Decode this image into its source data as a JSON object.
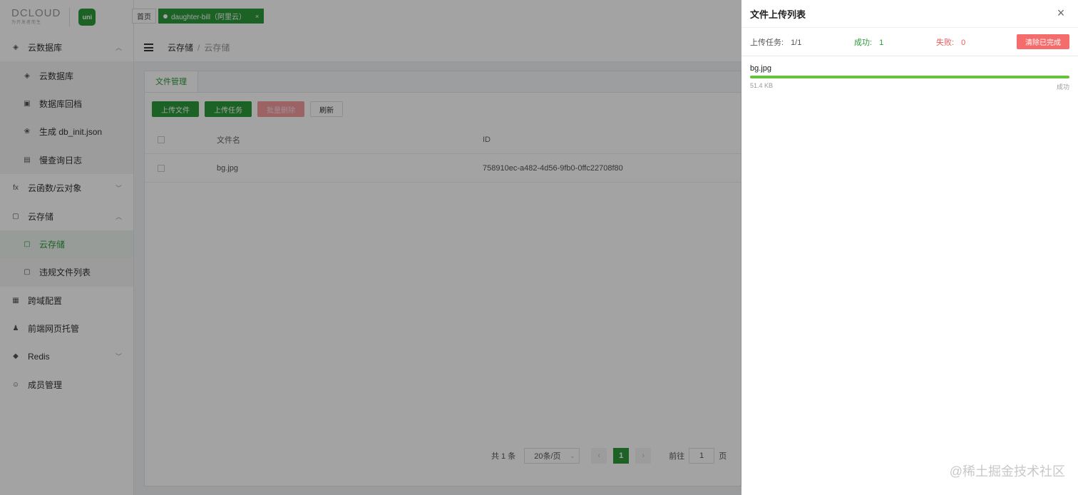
{
  "logo": {
    "dcloud": "DCLOUD",
    "dcloud_sub": "为开发者而生",
    "uni": "uni"
  },
  "tabs": {
    "home": "首页",
    "current": "daughter-bill（阿里云）",
    "close": "×"
  },
  "breadcrumb": {
    "first": "云存储",
    "sep": "/",
    "last": "云存储"
  },
  "sidebar": {
    "items": [
      {
        "label": "云数据库",
        "icon": "◈",
        "chev": "︿"
      },
      {
        "label": "云数据库",
        "icon": "◈"
      },
      {
        "label": "数据库回档",
        "icon": "▣"
      },
      {
        "label": "生成 db_init.json",
        "icon": "❀"
      },
      {
        "label": "慢查询日志",
        "icon": "▤"
      },
      {
        "label": "云函数/云对象",
        "icon": "fx",
        "chev": "﹀"
      },
      {
        "label": "云存储",
        "icon": "▢",
        "chev": "︿"
      },
      {
        "label": "云存储",
        "icon": "▢"
      },
      {
        "label": "违规文件列表",
        "icon": "▢"
      },
      {
        "label": "跨域配置",
        "icon": "▦"
      },
      {
        "label": "前端网页托管",
        "icon": "♟"
      },
      {
        "label": "Redis",
        "icon": "◆",
        "chev": "﹀"
      },
      {
        "label": "成员管理",
        "icon": "☺"
      }
    ]
  },
  "card": {
    "tab": "文件管理",
    "buttons": {
      "upload_file": "上传文件",
      "upload_task": "上传任务",
      "batch_delete": "批量删除",
      "refresh": "刷新"
    },
    "table": {
      "headers": {
        "name": "文件名",
        "id": "ID"
      },
      "rows": [
        {
          "name": "bg.jpg",
          "id": "758910ec-a482-4d56-9fb0-0ffc22708f80"
        }
      ]
    },
    "pager": {
      "total": "共 1 条",
      "size": "20条/页",
      "caret": "⌄",
      "prev": "‹",
      "page": "1",
      "next": "›",
      "goto": "前往",
      "goto_value": "1",
      "goto_unit": "页"
    }
  },
  "drawer": {
    "title": "文件上传列表",
    "close": "×",
    "stats": {
      "total_label": "上传任务:",
      "total_value": "1/1",
      "ok_label": "成功:",
      "ok_value": "1",
      "fail_label": "失败:",
      "fail_value": "0"
    },
    "clear_button": "清除已完成",
    "file": {
      "name": "bg.jpg",
      "size": "51.4 KB",
      "status": "成功",
      "progress": 1.0
    }
  },
  "watermark": "@稀土掘金技术社区",
  "colors": {
    "primary": "#2b9939",
    "danger": "#f56c6c",
    "progress": "#67c23a"
  }
}
